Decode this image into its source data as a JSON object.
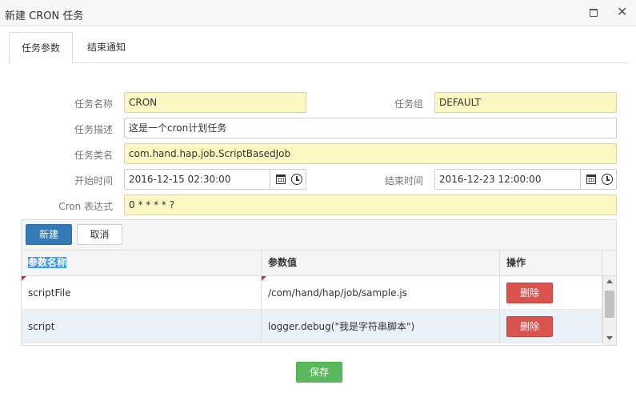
{
  "window": {
    "title": "新建 CRON 任务",
    "maximize_icon": "maximize-icon",
    "close_icon": "close-icon",
    "close_glyph": "✕"
  },
  "tabs": [
    {
      "label": "任务参数",
      "active": true
    },
    {
      "label": "结束通知",
      "active": false
    }
  ],
  "form": {
    "job_name": {
      "label": "任务名称",
      "value": "CRON",
      "required": true
    },
    "job_group": {
      "label": "任务组",
      "value": "DEFAULT",
      "required": true
    },
    "job_description": {
      "label": "任务描述",
      "value": "这是一个cron计划任务",
      "required": false
    },
    "job_class": {
      "label": "任务类名",
      "value": "com.hand.hap.job.ScriptBasedJob",
      "required": true
    },
    "start_time": {
      "label": "开始时间",
      "value": "2016-12-15 02:30:00",
      "required": false
    },
    "end_time": {
      "label": "结束时间",
      "value": "2016-12-23 12:00:00",
      "required": false
    },
    "cron_expression": {
      "label": "Cron 表达式",
      "value": "0 * * * * ?",
      "required": true
    }
  },
  "grid": {
    "toolbar": {
      "new_label": "新建",
      "cancel_label": "取消"
    },
    "columns": [
      "参数名称",
      "参数值",
      "操作"
    ],
    "rows": [
      {
        "name": "scriptFile",
        "value": "/com/hand/hap/job/sample.js",
        "action": "删除",
        "dirty": true
      },
      {
        "name": "script",
        "value": "logger.debug(\"我是字符串脚本\")",
        "action": "删除",
        "dirty": false
      }
    ]
  },
  "footer": {
    "save_label": "保存"
  },
  "colors": {
    "required_bg": "#fdf7c3",
    "primary": "#337ab7",
    "danger": "#d9534f",
    "success": "#5cb85c"
  }
}
